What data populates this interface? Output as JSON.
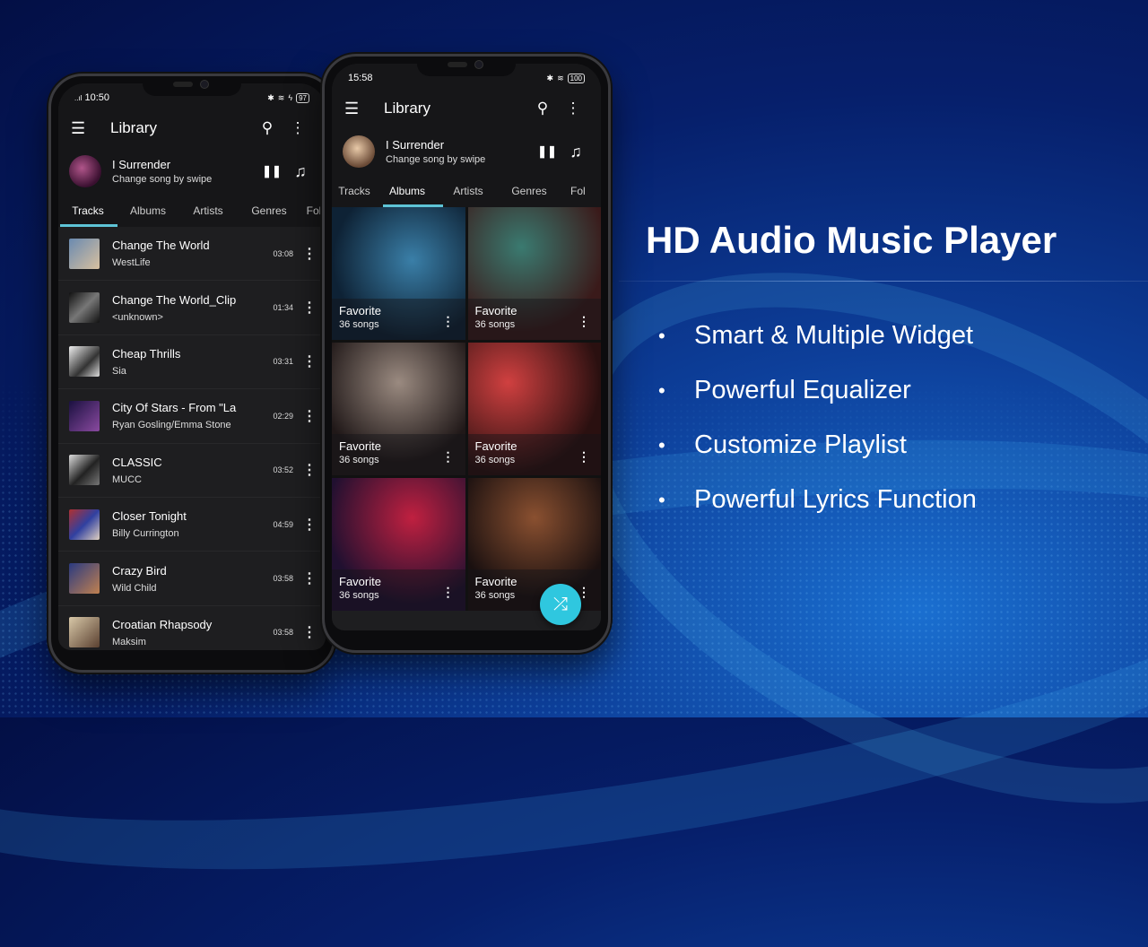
{
  "promo": {
    "title": "HD Audio Music Player",
    "bullet": "•",
    "features": [
      "Smart & Multiple Widget",
      "Powerful Equalizer",
      "Customize Playlist",
      "Powerful Lyrics Function"
    ]
  },
  "phone_left": {
    "status": {
      "signal": "..ıl",
      "time": "10:50",
      "bluetooth": "✱",
      "wifi": "≋",
      "charging": "ϟ",
      "battery": "97"
    },
    "appbar": {
      "menu_icon": "☰",
      "title": "Library",
      "search_icon": "⚲",
      "more_icon": "⋮"
    },
    "now_playing": {
      "title": "I Surrender",
      "subtitle": "Change song by swipe",
      "pause_icon": "❚❚",
      "queue_icon": "♫"
    },
    "tabs": [
      "Tracks",
      "Albums",
      "Artists",
      "Genres",
      "Fol"
    ],
    "active_tab": "Tracks",
    "tracks": [
      {
        "title": "Change The World",
        "artist": "WestLife",
        "duration": "03:08"
      },
      {
        "title": "Change The World_Clip",
        "artist": "<unknown>",
        "duration": "01:34"
      },
      {
        "title": "Cheap Thrills",
        "artist": "Sia",
        "duration": "03:31"
      },
      {
        "title": "City Of Stars - From \"La",
        "artist": "Ryan Gosling/Emma Stone",
        "duration": "02:29"
      },
      {
        "title": "CLASSIC",
        "artist": "MUCC",
        "duration": "03:52"
      },
      {
        "title": "Closer Tonight",
        "artist": "Billy Currington",
        "duration": "04:59"
      },
      {
        "title": "Crazy Bird",
        "artist": "Wild Child",
        "duration": "03:58"
      },
      {
        "title": "Croatian Rhapsody",
        "artist": "Maksim",
        "duration": "03:58"
      }
    ],
    "more_icon": "⋮"
  },
  "phone_right": {
    "status": {
      "time": "15:58",
      "bluetooth": "✱",
      "wifi": "≋",
      "battery": "100"
    },
    "appbar": {
      "menu_icon": "☰",
      "title": "Library",
      "search_icon": "⚲",
      "more_icon": "⋮"
    },
    "now_playing": {
      "title": "I Surrender",
      "subtitle": "Change song by swipe",
      "pause_icon": "❚❚",
      "queue_icon": "♫"
    },
    "tabs": [
      "Tracks",
      "Albums",
      "Artists",
      "Genres",
      "Fol"
    ],
    "active_tab": "Albums",
    "albums": [
      {
        "name": "Favorite",
        "count": "36 songs"
      },
      {
        "name": "Favorite",
        "count": "36 songs"
      },
      {
        "name": "Favorite",
        "count": "36 songs"
      },
      {
        "name": "Favorite",
        "count": "36 songs"
      },
      {
        "name": "Favorite",
        "count": "36 songs"
      },
      {
        "name": "Favorite",
        "count": "36 songs"
      }
    ],
    "more_icon": "⋮",
    "shuffle_icon": "⤮"
  },
  "colors": {
    "accent": "#5ec4d6",
    "fab": "#2fc7df",
    "surface": "#1e1e20"
  }
}
